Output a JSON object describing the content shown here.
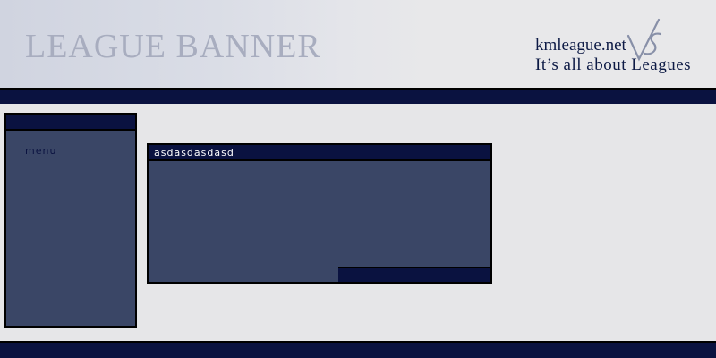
{
  "header": {
    "banner_title": "LEAGUE BANNER",
    "site_name": "kmleague.net",
    "tagline": "It’s all about Leagues",
    "logo_icon": "vs-logo-icon"
  },
  "sidebar": {
    "menu_label": "menu"
  },
  "panel": {
    "title": "asdasdasdasd"
  },
  "colors": {
    "navy": "#0a1240",
    "panel_fill": "#3a4666",
    "background": "#e6e6e8",
    "banner_text": "#a8adbf"
  }
}
